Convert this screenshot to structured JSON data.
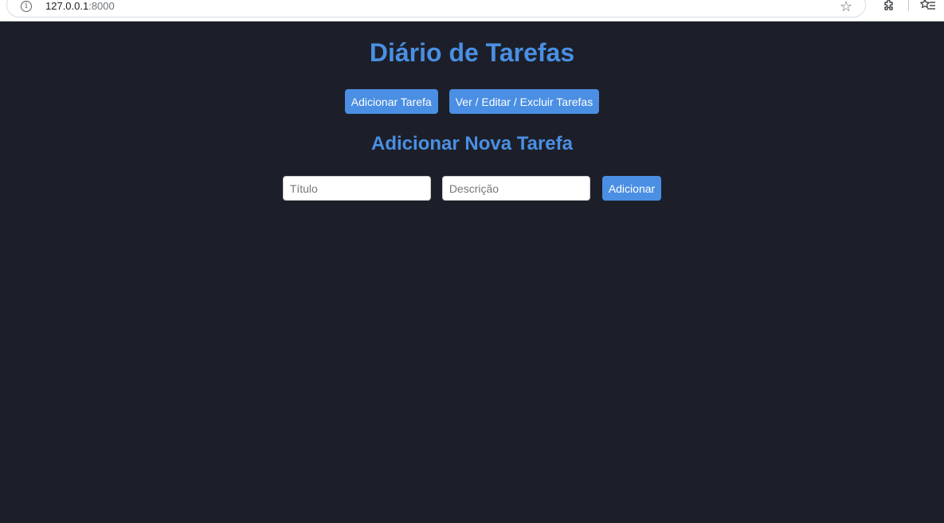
{
  "browser": {
    "url_host": "127.0.0.1",
    "url_port": ":8000",
    "info_icon": "info-icon",
    "bookmark_icon": "star-icon",
    "extensions_icon": "puzzle-icon",
    "reading_list_icon": "reading-list-icon"
  },
  "page": {
    "title": "Diário de Tarefas",
    "nav": {
      "add_task_label": "Adicionar Tarefa",
      "manage_tasks_label": "Ver / Editar / Excluir Tarefas"
    },
    "section_title": "Adicionar Nova Tarefa",
    "form": {
      "title_value": "",
      "title_placeholder": "Título",
      "description_value": "",
      "description_placeholder": "Descrição",
      "submit_label": "Adicionar"
    }
  },
  "colors": {
    "background": "#1c1f29",
    "accent": "#4a8fe3",
    "button_text": "#ffffff"
  }
}
